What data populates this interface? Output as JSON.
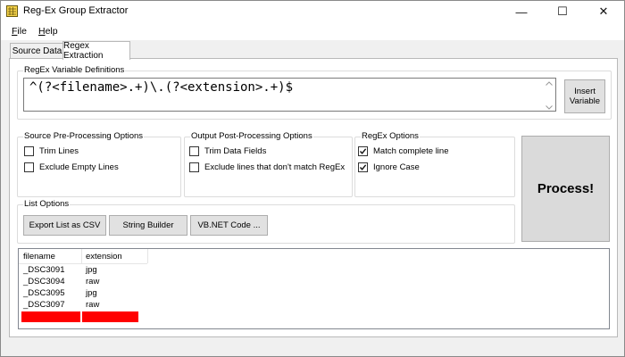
{
  "window": {
    "title": "Reg-Ex Group Extractor",
    "minimize_glyph": "—",
    "maximize_glyph": "☐",
    "close_glyph": "✕"
  },
  "menu": {
    "file": {
      "accel": "F",
      "rest": "ile"
    },
    "help": {
      "accel": "H",
      "rest": "elp"
    }
  },
  "tabs": [
    {
      "label": "Source Data",
      "active": false
    },
    {
      "label": "Regex Extraction",
      "active": true
    }
  ],
  "regex_definitions": {
    "group_title": "RegEx Variable Definitions",
    "value": "^(?<filename>.+)\\.(?<extension>.+)$",
    "insert_button": "Insert Variable"
  },
  "source_preprocessing": {
    "group_title": "Source Pre-Processing Options",
    "trim_lines": {
      "label": "Trim Lines",
      "checked": false
    },
    "exclude_empty": {
      "label": "Exclude Empty Lines",
      "checked": false
    }
  },
  "output_postprocessing": {
    "group_title": "Output Post-Processing Options",
    "trim_fields": {
      "label": "Trim Data Fields",
      "checked": false
    },
    "exclude_nonmatch": {
      "label": "Exclude lines that don't match RegEx",
      "checked": false
    }
  },
  "regex_options": {
    "group_title": "RegEx Options",
    "match_complete": {
      "label": "Match complete line",
      "checked": true
    },
    "ignore_case": {
      "label": "Ignore Case",
      "checked": true
    }
  },
  "process_button": "Process!",
  "list_options": {
    "group_title": "List Options",
    "export_csv": "Export List as CSV",
    "string_builder": "String Builder",
    "vbnet_code": "VB.NET Code ..."
  },
  "results": {
    "columns": [
      "filename",
      "extension"
    ],
    "rows": [
      [
        "_DSC3091",
        "jpg"
      ],
      [
        "_DSC3094",
        "raw"
      ],
      [
        "_DSC3095",
        "jpg"
      ],
      [
        "_DSC3097",
        "raw"
      ]
    ],
    "highlight_color": "#ff0000"
  },
  "icons": {
    "app": "app-grid-icon",
    "check": "check-icon",
    "scroll_up": "chevron-up-icon",
    "scroll_down": "chevron-down-icon"
  }
}
